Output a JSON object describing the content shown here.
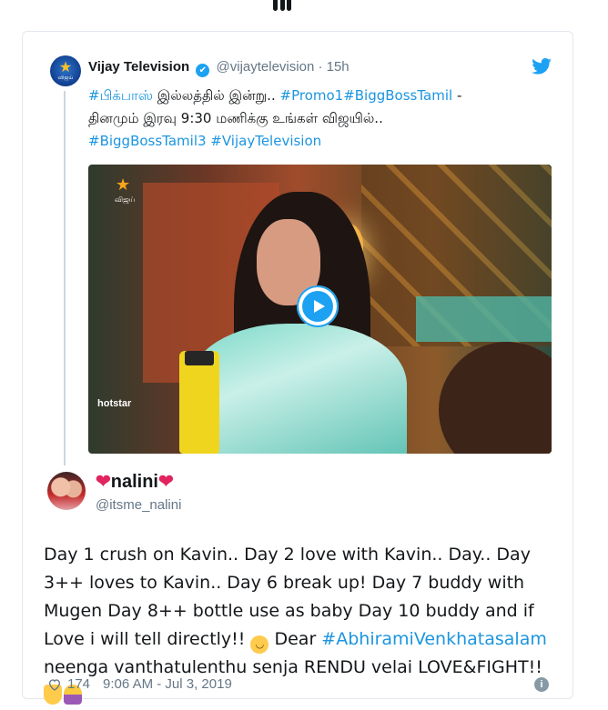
{
  "quoted_tweet": {
    "author_name": "Vijay Television",
    "verified_mark": "✔",
    "handle_and_time": "@vijaytelevision · 15h",
    "avatar_text": "விஜய்",
    "line1_hashtag": "#பிக்பாஸ்",
    "line1_text": " இல்லத்தில் இன்று.. ",
    "line1_hashtag2": "#Promo1#BiggBossTamil",
    "line1_tail": " -",
    "line2_text": "தினமும் இரவு 9:30 மணிக்கு உங்கள் விஜயில்..",
    "line3_hashtags": "#BiggBossTamil3 #VijayTelevision",
    "video": {
      "channel_logo_text": "விஜய்",
      "watermark": "hotstar"
    }
  },
  "tweet": {
    "display_name_heart_left": "❤",
    "display_name": "nalini",
    "display_name_heart_right": "❤",
    "handle": "@itsme_nalini",
    "text_part1": "Day 1 crush on Kavin.. Day 2 love with Kavin.. Day.. Day 3++ loves to Kavin.. Day 6 break up! Day 7 buddy with Mugen Day 8++ bottle use as baby Day 10 buddy and if Love i will tell directly!! ",
    "text_part2": " Dear ",
    "mention_hashtag": "#AbhiramiVenkhatasalam",
    "text_part3": " neenga vanthatulenthu senja RENDU velai LOVE&FIGHT!! ",
    "likes": "174",
    "timestamp": "9:06 AM - Jul 3, 2019",
    "info_symbol": "i"
  },
  "icons": {
    "bird": "twitter-bird-icon",
    "heart": "heart-outline-icon",
    "info": "info-icon"
  },
  "colors": {
    "link": "#1b95e0",
    "twitter_blue": "#1da1f2",
    "heart": "#e0245e",
    "muted": "#657786"
  }
}
